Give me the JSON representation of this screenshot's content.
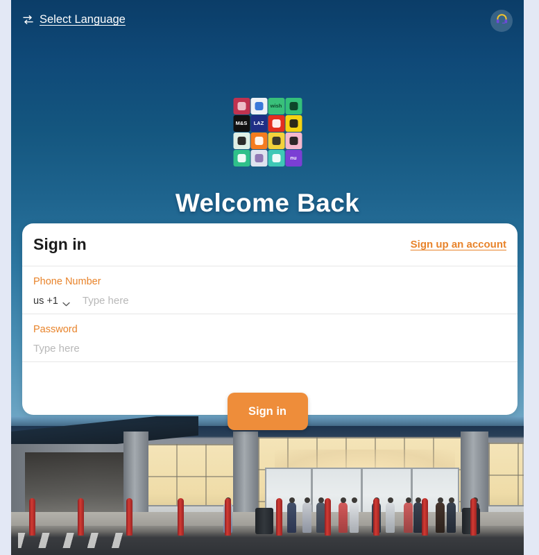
{
  "topbar": {
    "language_link": "Select Language",
    "swap_icon": "swap-arrows-icon",
    "support_icon": "headset-icon"
  },
  "hero": {
    "heading": "Welcome Back",
    "logo_grid": [
      {
        "name": "home-app-icon",
        "text": "",
        "bg": "#c0324f",
        "fg": "#f2c9d3"
      },
      {
        "name": "wallet-app-icon",
        "text": "",
        "bg": "#eef2f6",
        "fg": "#2a6fd6"
      },
      {
        "name": "wish-app-icon",
        "text": "wish",
        "bg": "#39c07a",
        "fg": "#0e4a2c"
      },
      {
        "name": "tripadvisor-app-icon",
        "text": "",
        "bg": "#34c07a",
        "fg": "#0b3d24"
      },
      {
        "name": "mands-app-icon",
        "text": "M&S",
        "bg": "#111111",
        "fg": "#ffffff"
      },
      {
        "name": "lazada-app-icon",
        "text": "LAZ",
        "bg": "#1f2f86",
        "fg": "#ffffff"
      },
      {
        "name": "aliexpress-app-icon",
        "text": "",
        "bg": "#e32f1e",
        "fg": "#ffffff"
      },
      {
        "name": "smiley-app-icon",
        "text": "",
        "bg": "#f5d312",
        "fg": "#1a1a1a"
      },
      {
        "name": "leaf-app-icon",
        "text": "",
        "bg": "#dff0e6",
        "fg": "#1b1b1b"
      },
      {
        "name": "wave-app-icon",
        "text": "",
        "bg": "#f57c20",
        "fg": "#ffffff"
      },
      {
        "name": "handshake-app-icon",
        "text": "",
        "bg": "#f3d23b",
        "fg": "#2b2b2b"
      },
      {
        "name": "diamond-app-icon",
        "text": "",
        "bg": "#f5b8cd",
        "fg": "#1a1a1a"
      },
      {
        "name": "cat-app-icon",
        "text": "",
        "bg": "#2fc08a",
        "fg": "#ffffff"
      },
      {
        "name": "sparkle-app-icon",
        "text": "",
        "bg": "#dfe3ef",
        "fg": "#8a6fb0"
      },
      {
        "name": "hand-app-icon",
        "text": "",
        "bg": "#3fc8b6",
        "fg": "#ffffff"
      },
      {
        "name": "nubank-app-icon",
        "text": "nu",
        "bg": "#7b3fd4",
        "fg": "#ffffff"
      }
    ]
  },
  "card": {
    "title": "Sign in",
    "signup_link": "Sign up an account",
    "phone": {
      "label": "Phone Number",
      "country_code": "us +1",
      "chevron_icon": "chevron-down-icon",
      "value": "",
      "placeholder": "Type here"
    },
    "password": {
      "label": "Password",
      "value": "",
      "placeholder": "Type here"
    },
    "submit_label": "Sign in"
  },
  "colors": {
    "accent_orange": "#e8832a",
    "button_orange": "#ee8d3a",
    "card_bg": "#ffffff",
    "sky_top": "#0b3d68",
    "sky_bottom": "#72a8c6",
    "page_edge": "#e3e8f5"
  }
}
